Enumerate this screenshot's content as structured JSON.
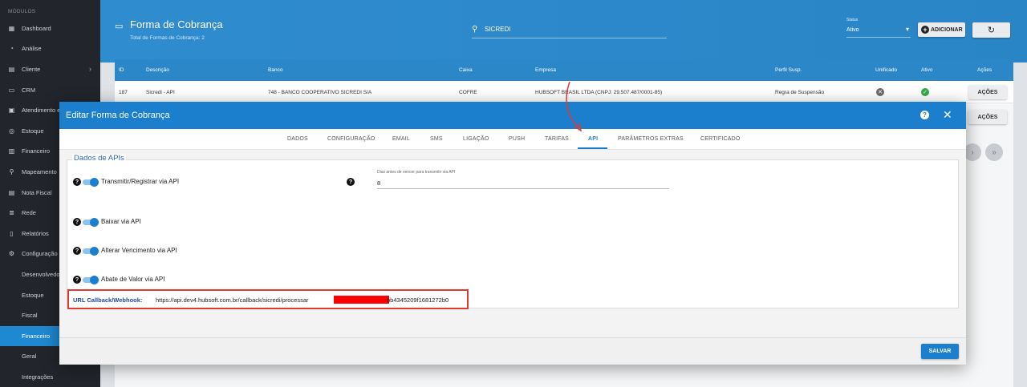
{
  "sidebar": {
    "section": "MÓDULOS",
    "items": [
      {
        "label": "Dashboard",
        "icon": "dashboard-icon",
        "glyph": "▦"
      },
      {
        "label": "Análise",
        "icon": "analytics-icon",
        "glyph": "◔"
      },
      {
        "label": "Cliente",
        "icon": "client-icon",
        "glyph": "▤",
        "chevron": "›"
      },
      {
        "label": "CRM",
        "icon": "crm-icon",
        "glyph": "▭"
      },
      {
        "label": "Atendimento e...",
        "icon": "support-icon",
        "glyph": "▣"
      },
      {
        "label": "Estoque",
        "icon": "stock-icon",
        "glyph": "◎"
      },
      {
        "label": "Financeiro",
        "icon": "finance-icon",
        "glyph": "▥"
      },
      {
        "label": "Mapeamento",
        "icon": "map-pin-icon",
        "glyph": "⚲"
      },
      {
        "label": "Nota Fiscal",
        "icon": "invoice-icon",
        "glyph": "▤"
      },
      {
        "label": "Rede",
        "icon": "network-icon",
        "glyph": "≣"
      },
      {
        "label": "Relatórios",
        "icon": "report-icon",
        "glyph": "▯"
      },
      {
        "label": "Configuração",
        "icon": "gear-icon",
        "glyph": "⚙"
      }
    ],
    "subitems": [
      {
        "label": "Desenvolvedor"
      },
      {
        "label": "Estoque"
      },
      {
        "label": "Fiscal"
      },
      {
        "label": "Financeiro",
        "active": true
      },
      {
        "label": "Geral"
      },
      {
        "label": "Integrações"
      }
    ]
  },
  "header": {
    "title": "Forma de Cobrança",
    "subtitle": "Total de Formas de Cobrança: 2",
    "search_value": "SICREDI",
    "status_label": "Status",
    "status_value": "Ativo",
    "add_label": "ADICIONAR"
  },
  "table": {
    "columns": [
      "ID",
      "Descrição",
      "Banco",
      "Caixa",
      "Empresa",
      "Perfil Susp.",
      "Unificado",
      "Ativo",
      "Ações"
    ],
    "row": {
      "id": "187",
      "descricao": "Sicredi - API",
      "banco": "748 - BANCO COOPERATIVO SICREDI S/A",
      "caixa": "COFRE",
      "empresa": "HUBSOFT BRASIL LTDA (CNPJ: 29.507.487/0001-85)",
      "perfil": "Regra de Suspensão"
    },
    "actions_label": "AÇÕES",
    "pager_next": "›",
    "pager_last": "»"
  },
  "modal": {
    "title": "Editar Forma de Cobrança",
    "tabs": [
      {
        "label": "DADOS"
      },
      {
        "label": "CONFIGURAÇÃO"
      },
      {
        "label": "EMAIL"
      },
      {
        "label": "SMS"
      },
      {
        "label": "LIGAÇÃO"
      },
      {
        "label": "PUSH"
      },
      {
        "label": "TARIFAS"
      },
      {
        "label": "API",
        "active": true
      },
      {
        "label": "PARÂMETROS EXTRAS"
      },
      {
        "label": "CERTIFICADO"
      }
    ],
    "panel_title": "Dados de APIs",
    "options": [
      {
        "label": "Transmitir/Registrar via API",
        "enabled": true
      },
      {
        "label": "Baixar via API",
        "enabled": true
      },
      {
        "label": "Alterar Vencimento via API",
        "enabled": true
      },
      {
        "label": "Abate de Valor via API",
        "enabled": true
      }
    ],
    "days_field": {
      "label": "Dias antes de vencer para transmitir via API",
      "value": "8"
    },
    "callback": {
      "label": "URL Callback/Webhook:",
      "value_start": "https://api.dev4.hubsoft.com.br/callback/sicredi/processar",
      "value_end": "bb4345209f1681272b0"
    },
    "save_label": "SALVAR"
  },
  "colors": {
    "primary": "#1b7fcd",
    "sidebar_bg": "#22252b",
    "highlight": "#e03b32"
  }
}
